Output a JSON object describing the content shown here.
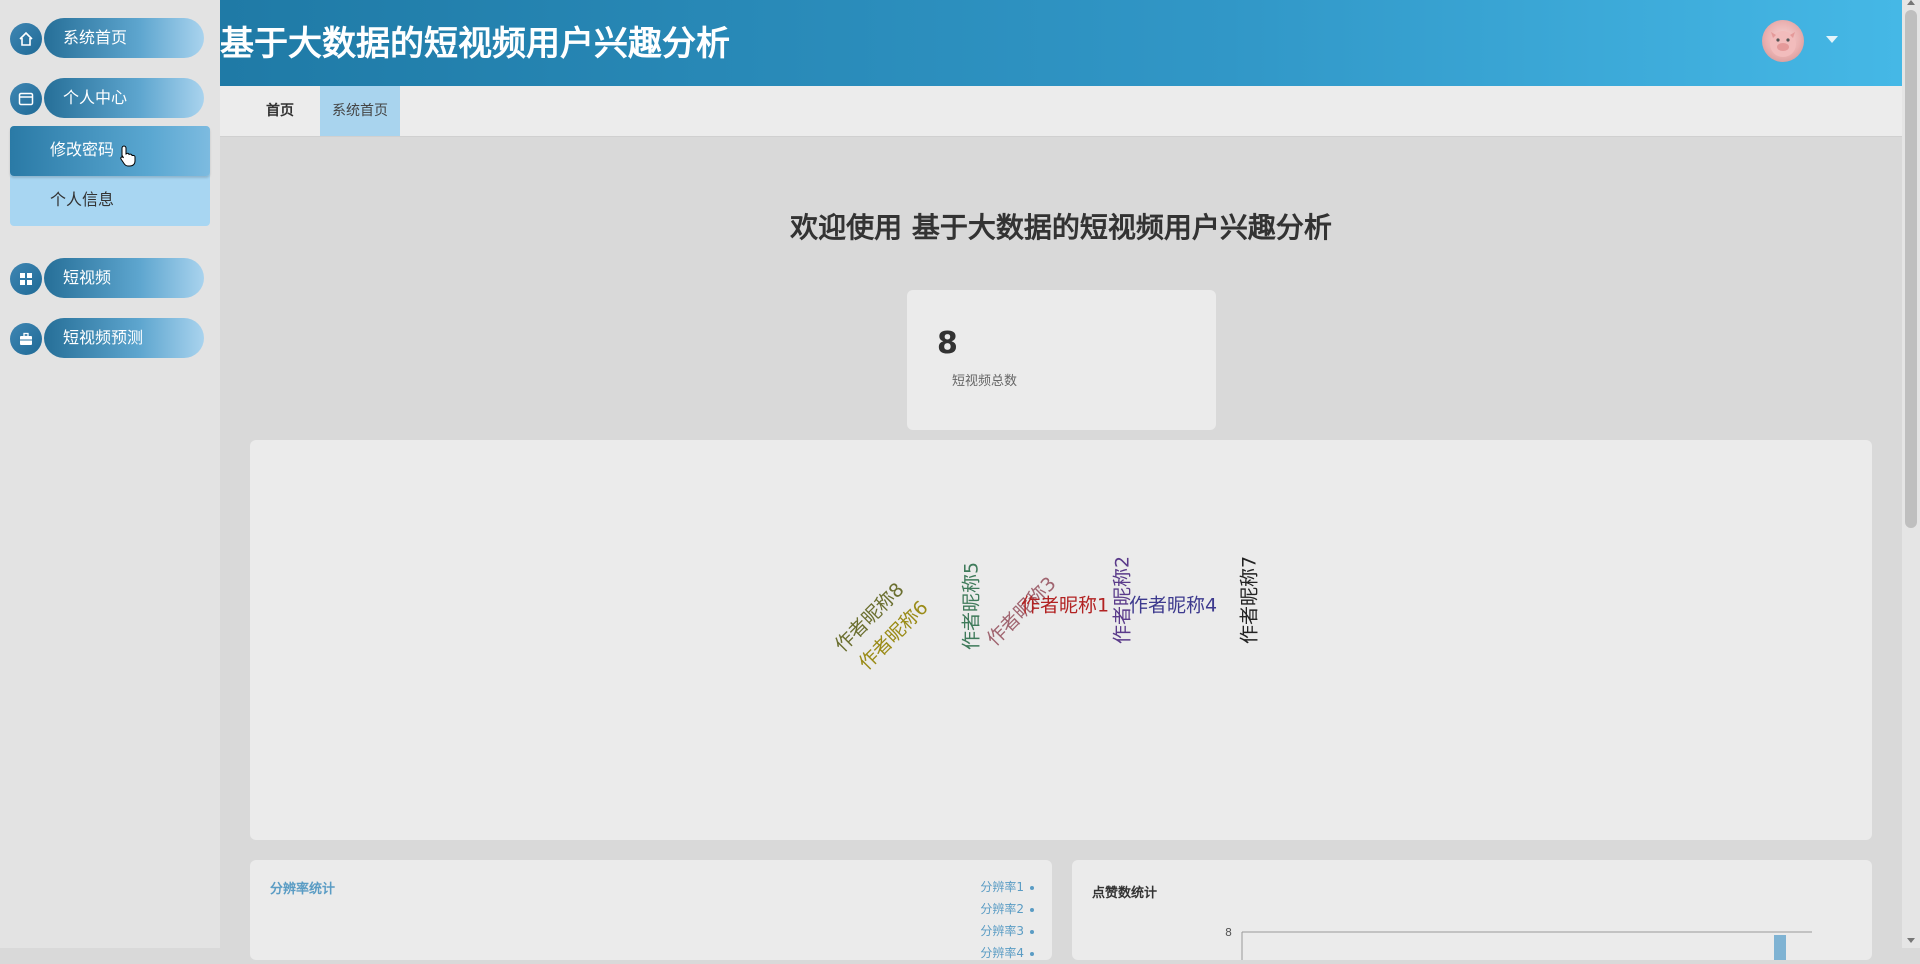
{
  "app": {
    "title": "基于大数据的短视频用户兴趣分析"
  },
  "sidebar": {
    "items": [
      {
        "label": "系统首页",
        "icon": "home-icon"
      },
      {
        "label": "个人中心",
        "icon": "user-card-icon"
      },
      {
        "label": "短视频",
        "icon": "grid-icon"
      },
      {
        "label": "短视频预测",
        "icon": "briefcase-icon"
      }
    ],
    "submenu": [
      {
        "label": "修改密码"
      },
      {
        "label": "个人信息"
      }
    ]
  },
  "tabs": [
    {
      "label": "首页"
    },
    {
      "label": "系统首页"
    }
  ],
  "main": {
    "welcome": "欢迎使用 基于大数据的短视频用户兴趣分析",
    "stat": {
      "value": "8",
      "label": "短视频总数"
    }
  },
  "chart_data": [
    {
      "type": "wordcloud",
      "words": [
        {
          "text": "作者昵称8",
          "color": "#6b6f30"
        },
        {
          "text": "作者昵称6",
          "color": "#9a8b17"
        },
        {
          "text": "作者昵称5",
          "color": "#3e7a5a"
        },
        {
          "text": "作者昵称3",
          "color": "#a06570"
        },
        {
          "text": "作者昵称1",
          "color": "#b22222"
        },
        {
          "text": "作者昵称2",
          "color": "#5a3a8a"
        },
        {
          "text": "作者昵称4",
          "color": "#3d3a8e"
        },
        {
          "text": "作者昵称7",
          "color": "#222222"
        }
      ]
    },
    {
      "type": "pie",
      "title": "分辨率统计",
      "legend": [
        "分辨率1",
        "分辨率2",
        "分辨率3",
        "分辨率4"
      ]
    },
    {
      "type": "bar",
      "title": "点赞数统计",
      "ytick_visible": "8"
    }
  ],
  "colors": {
    "accent": "#2a85b5",
    "header_end": "#45b8e6",
    "submenu_bg": "#a8d6f2"
  }
}
